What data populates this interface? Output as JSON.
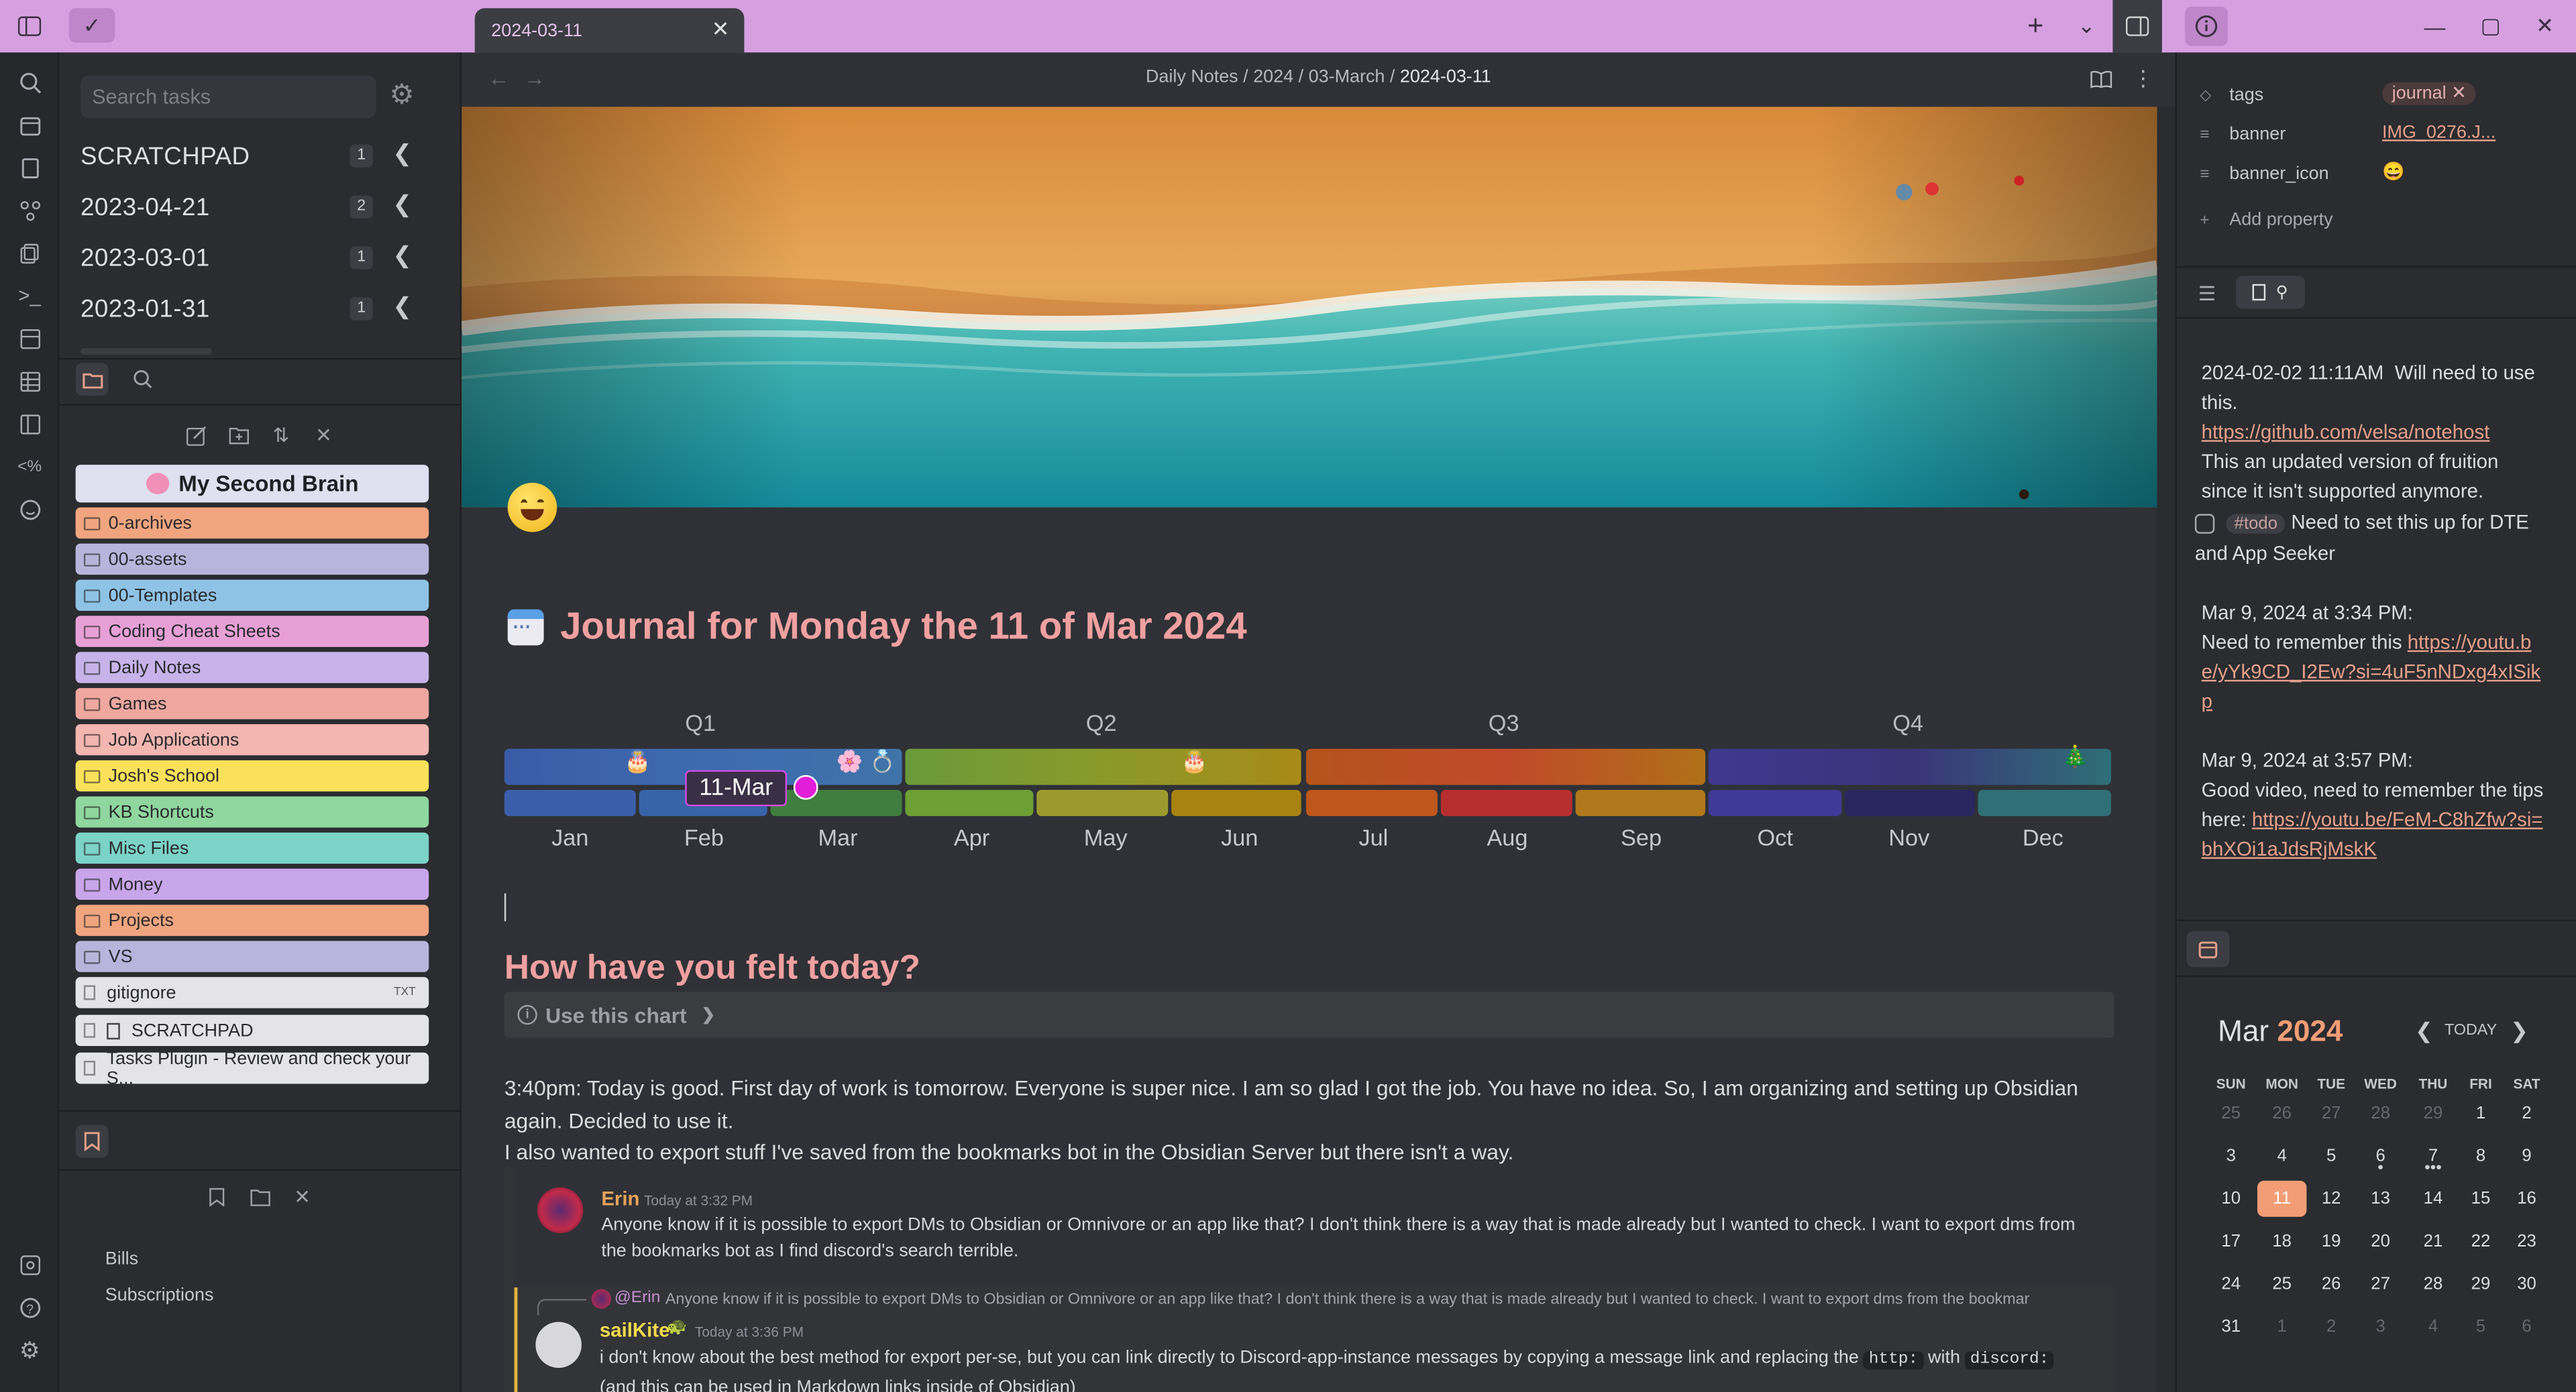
{
  "app": {
    "tab_title": "2024-03-11"
  },
  "breadcrumb": {
    "parts": [
      "Daily Notes",
      "2024",
      "03-March",
      "2024-03-11"
    ],
    "sep": "/"
  },
  "left_sidebar": {
    "search_placeholder": "Search tasks",
    "task_groups": [
      {
        "name": "SCRATCHPAD",
        "count": "1"
      },
      {
        "name": "2023-04-21",
        "count": "2"
      },
      {
        "name": "2023-03-01",
        "count": "1"
      },
      {
        "name": "2023-01-31",
        "count": "1"
      }
    ],
    "vault_name": "My Second Brain",
    "folders": [
      {
        "name": "0-archives",
        "color": "#f1a57f"
      },
      {
        "name": "00-assets",
        "color": "#b8b5dd"
      },
      {
        "name": "00-Templates",
        "color": "#8fc3e6"
      },
      {
        "name": "Coding Cheat Sheets",
        "color": "#e7a0d6"
      },
      {
        "name": "Daily Notes",
        "color": "#c7b3ea"
      },
      {
        "name": "Games",
        "color": "#f0a7a0"
      },
      {
        "name": "Job Applications",
        "color": "#f3b6b0"
      },
      {
        "name": "Josh's School",
        "color": "#fbe15a"
      },
      {
        "name": "KB Shortcuts",
        "color": "#8fd79e"
      },
      {
        "name": "Misc Files",
        "color": "#7cd3c8"
      },
      {
        "name": "Money",
        "color": "#c9a5ea"
      },
      {
        "name": "Projects",
        "color": "#f1a57f"
      },
      {
        "name": "VS",
        "color": "#b8b5dd"
      }
    ],
    "files": [
      {
        "name": "gitignore",
        "badge": "TXT"
      },
      {
        "name": "SCRATCHPAD",
        "badge": ""
      },
      {
        "name": "Tasks Plugin - Review and check your S...",
        "badge": ""
      }
    ],
    "bookmarks": [
      "Bills",
      "Subscriptions"
    ]
  },
  "main": {
    "title": "Journal for Monday the 11 of Mar 2024",
    "quarters": [
      "Q1",
      "Q2",
      "Q3",
      "Q4"
    ],
    "months": [
      "Jan",
      "Feb",
      "Mar",
      "Apr",
      "May",
      "Jun",
      "Jul",
      "Aug",
      "Sep",
      "Oct",
      "Nov",
      "Dec"
    ],
    "today_marker": "11-Mar",
    "heading2": "How have you felt today?",
    "callout": "Use this chart",
    "paragraph1": "3:40pm: Today is good. First day of work is tomorrow. Everyone is super nice. I am so glad I got the job. You have no idea. So, I am organizing and setting up Obsidian again. Decided to use it.",
    "paragraph2": "I also wanted to export stuff I've saved from the bookmarks bot in the Obsidian Server but there isn't a way.",
    "discord": {
      "msg1_author": "Erin",
      "msg1_time": "Today at 3:32 PM",
      "msg1_text": "Anyone know if it is possible to export DMs to Obsidian or Omnivore or an app like that? I don't think there is a way that is made already but I wanted to check. I want to export dms from the bookmarks bot as I find discord's search terrible.",
      "reply_preview_author": "@Erin",
      "reply_preview_text": "Anyone know if it is possible to export DMs to Obsidian or Omnivore or an app like that? I don't think there is a way that is made already but I wanted to check. I want to export dms from the bookmar",
      "msg2_author": "sailKite",
      "msg2_time": "Today at 3:36 PM",
      "msg2_text_a": "i don't know about the best method for export per-se, but you can link directly to Discord-app-instance messages by copying a message link and replacing the",
      "msg2_code1": "http:",
      "msg2_text_b": "with",
      "msg2_code2": "discord:",
      "msg2_text_c": "(and this can be used in Markdown links inside of Obsidian)"
    }
  },
  "right_sidebar": {
    "properties": [
      {
        "key": "tags",
        "value": "journal"
      },
      {
        "key": "banner",
        "value": "IMG_0276.J..."
      },
      {
        "key": "banner_icon",
        "value": "😄"
      }
    ],
    "add_property": "Add property",
    "note": {
      "entry1_time": "2024-02-02 11:11AM",
      "entry1_text": "Will need to use this.",
      "entry1_link": "https://github.com/velsa/notehost",
      "entry1_after": "This an updated version of fruition since it isn't supported anymore.",
      "todo_tag": "#todo",
      "todo_text": "Need to set this up for DTE and App Seeker",
      "entry2_time": "Mar 9, 2024 at 3:34 PM:",
      "entry2_text": "Need to remember this",
      "entry2_link": "https://youtu.be/yYk9CD_I2Ew?si=4uF5nNDxg4xISikp",
      "entry3_time": "Mar 9, 2024 at 3:57 PM:",
      "entry3_text": "Good video, need to remember the tips here:",
      "entry3_link": "https://youtu.be/FeM-C8hZfw?si=bhXOi1aJdsRjMskK"
    },
    "calendar": {
      "month": "Mar",
      "year": "2024",
      "today_label": "TODAY",
      "dows": [
        "SUN",
        "MON",
        "TUE",
        "WED",
        "THU",
        "FRI",
        "SAT"
      ],
      "weeks": [
        [
          "25",
          "26",
          "27",
          "28",
          "29",
          "1",
          "2"
        ],
        [
          "3",
          "4",
          "5",
          "6",
          "7",
          "8",
          "9"
        ],
        [
          "10",
          "11",
          "12",
          "13",
          "14",
          "15",
          "16"
        ],
        [
          "17",
          "18",
          "19",
          "20",
          "21",
          "22",
          "23"
        ],
        [
          "24",
          "25",
          "26",
          "27",
          "28",
          "29",
          "30"
        ],
        [
          "31",
          "1",
          "2",
          "3",
          "4",
          "5",
          "6"
        ]
      ]
    }
  }
}
